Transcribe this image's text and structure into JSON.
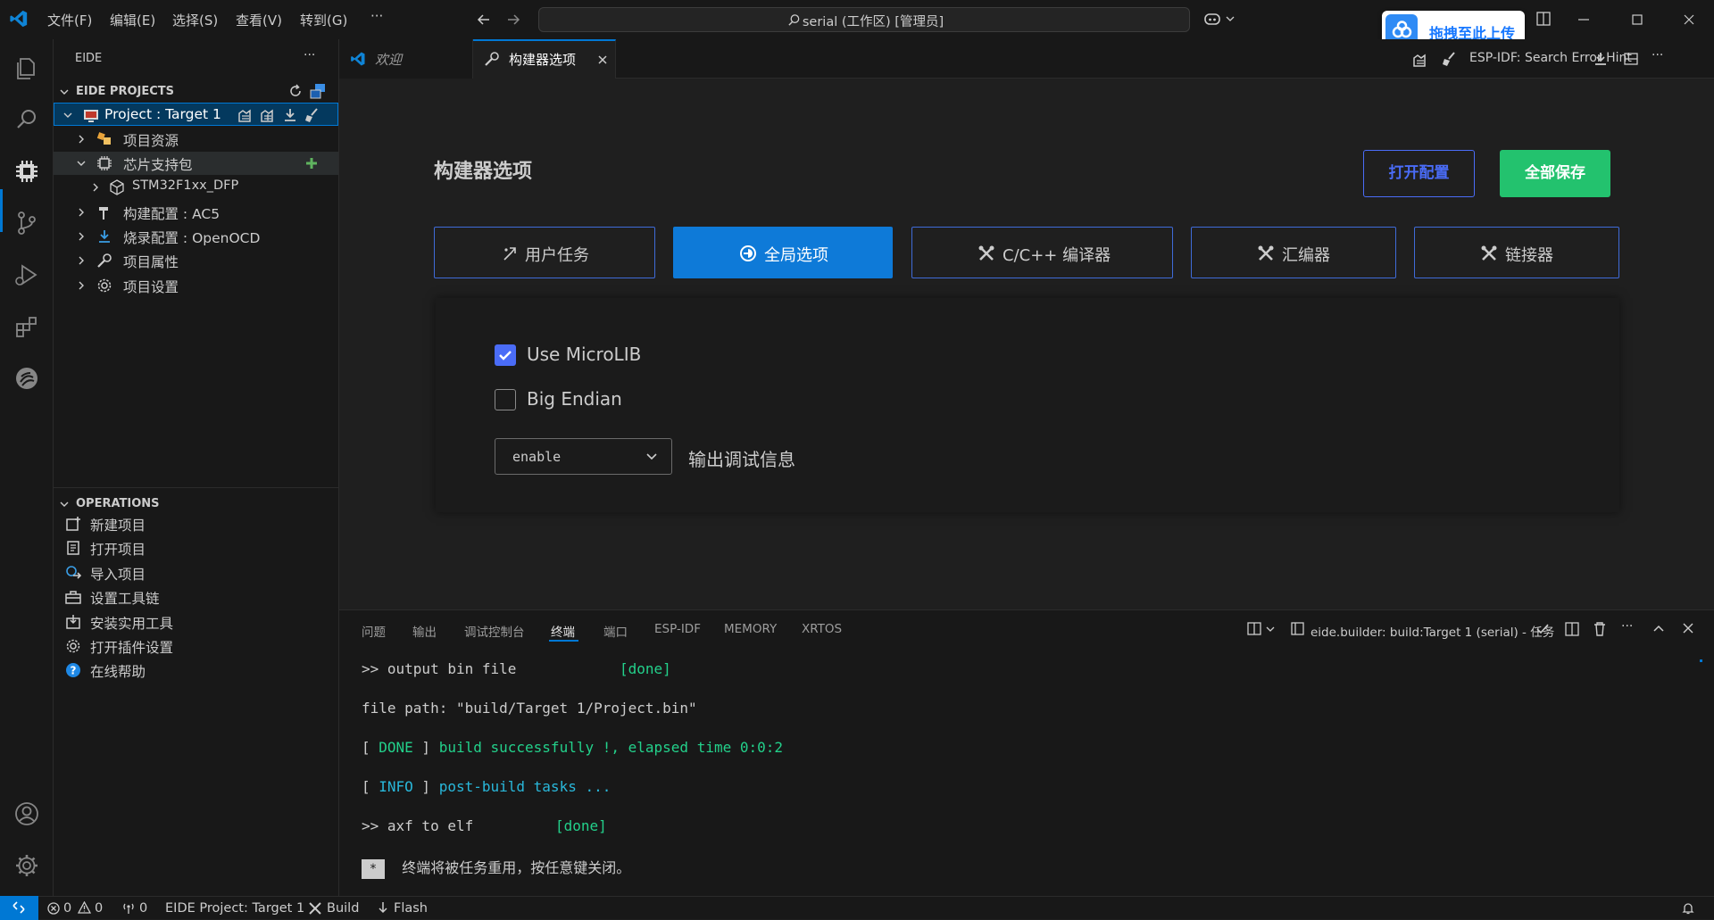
{
  "titlebar": {
    "menus": [
      "文件(F)",
      "编辑(E)",
      "选择(S)",
      "查看(V)",
      "转到(G)"
    ],
    "more": "···",
    "search_text": "serial (工作区) [管理员]",
    "upload_badge": "拖拽至此上传"
  },
  "sidebar": {
    "title": "EIDE",
    "more": "···",
    "projects_title": "EIDE PROJECTS",
    "tree": [
      {
        "label": "Project : Target 1"
      },
      {
        "label": "项目资源"
      },
      {
        "label": "芯片支持包"
      },
      {
        "label": "STM32F1xx_DFP"
      },
      {
        "label": "构建配置 : AC5"
      },
      {
        "label": "烧录配置 : OpenOCD"
      },
      {
        "label": "项目属性"
      },
      {
        "label": "项目设置"
      }
    ],
    "operations_title": "OPERATIONS",
    "operations": [
      "新建项目",
      "打开项目",
      "导入项目",
      "设置工具链",
      "安装实用工具",
      "打开插件设置",
      "在线帮助"
    ]
  },
  "tabs": [
    {
      "label": "欢迎"
    },
    {
      "label": "构建器选项"
    }
  ],
  "tabbar_right": {
    "hint": "ESP-IDF: Search Error Hint",
    "more": "···"
  },
  "editor": {
    "heading": "构建器选项",
    "open_config": "打开配置",
    "save_all": "全部保存",
    "option_tabs": [
      "用户任务",
      "全局选项",
      "C/C++ 编译器",
      "汇编器",
      "链接器"
    ],
    "use_microlib": "Use MicroLIB",
    "use_microlib_checked": true,
    "big_endian": "Big Endian",
    "big_endian_checked": false,
    "debug_select_value": "enable",
    "debug_label": "输出调试信息"
  },
  "panel": {
    "tabs": [
      "问题",
      "输出",
      "调试控制台",
      "终端",
      "端口",
      "ESP-IDF",
      "MEMORY",
      "XRTOS"
    ],
    "active_tab": "终端",
    "task_label": "eide.builder: build:Target 1 (serial) - 任务",
    "more": "···",
    "terminal": {
      "l1_cmd": ">> output bin file",
      "l1_status": "[done]",
      "l2": "file path: \"build/Target 1/Project.bin\"",
      "l3_open": "[ ",
      "l3_tag": "DONE",
      "l3_close": " ]",
      "l3_msg": "build successfully !, elapsed time 0:0:2",
      "l4_open": "[ ",
      "l4_tag": "INFO",
      "l4_close": " ]",
      "l4_msg": "post-build tasks ...",
      "l5_cmd": ">> axf to elf",
      "l5_status": "[done]",
      "l6_badge": "*",
      "l6_msg": "终端将被任务重用，按任意键关闭。"
    }
  },
  "statusbar": {
    "errors": "0",
    "warnings": "0",
    "ports": "0",
    "project": "EIDE Project: Target 1",
    "build": "Build",
    "flash": "Flash"
  },
  "colors": {
    "accent_blue": "#0078d4",
    "active_option_tab": "#0e7ad8",
    "save_green": "#23c26e",
    "outline_button": "#4a6cf7",
    "terminal_green": "#23d18b",
    "terminal_blue": "#29b8db"
  }
}
